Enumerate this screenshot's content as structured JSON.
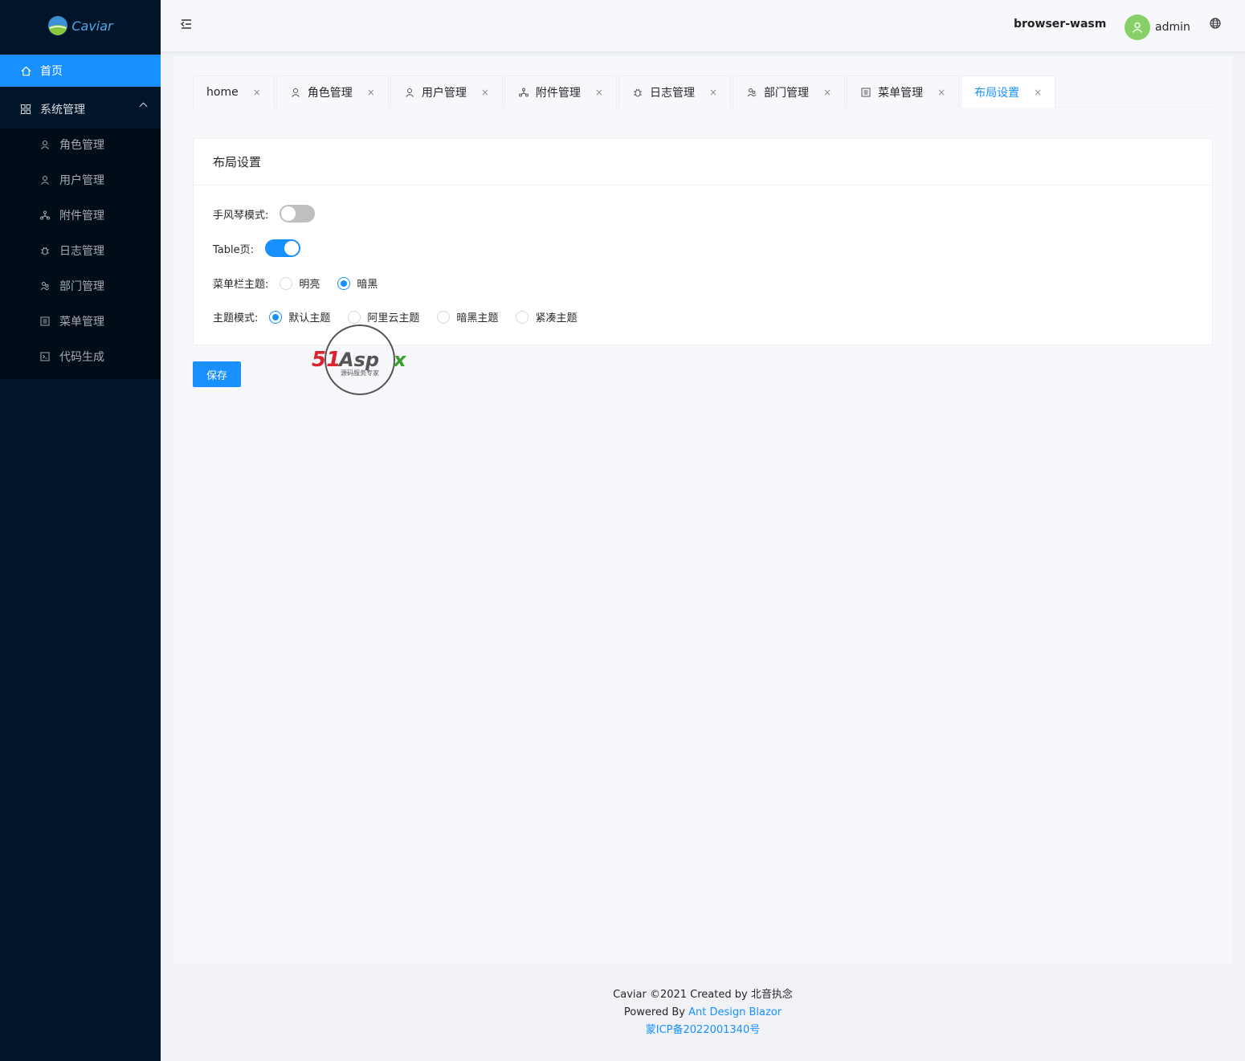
{
  "app": {
    "logo_text": "Caviar"
  },
  "sidebar": {
    "home": "首页",
    "group": "系统管理",
    "items": [
      {
        "label": "角色管理",
        "icon": "user-role-icon"
      },
      {
        "label": "用户管理",
        "icon": "user-icon"
      },
      {
        "label": "附件管理",
        "icon": "cluster-icon"
      },
      {
        "label": "日志管理",
        "icon": "bug-icon"
      },
      {
        "label": "部门管理",
        "icon": "team-icon"
      },
      {
        "label": "菜单管理",
        "icon": "profile-icon"
      },
      {
        "label": "代码生成",
        "icon": "code-icon"
      }
    ]
  },
  "header": {
    "env": "browser-wasm",
    "username": "admin"
  },
  "tabs": [
    {
      "label": "home",
      "close": "×"
    },
    {
      "label": "角色管理",
      "close": "×"
    },
    {
      "label": "用户管理",
      "close": "×"
    },
    {
      "label": "附件管理",
      "close": "×"
    },
    {
      "label": "日志管理",
      "close": "×"
    },
    {
      "label": "部门管理",
      "close": "×"
    },
    {
      "label": "菜单管理",
      "close": "×"
    },
    {
      "label": "布局设置",
      "close": "×"
    }
  ],
  "card": {
    "title": "布局设置",
    "accordion_label": "手风琴模式:",
    "accordion_on": false,
    "table_label": "Table页:",
    "table_on": true,
    "menu_theme_label": "菜单栏主题:",
    "menu_theme_options": [
      "明亮",
      "暗黑"
    ],
    "menu_theme_selected": "暗黑",
    "theme_mode_label": "主题模式:",
    "theme_mode_options": [
      "默认主题",
      "阿里云主题",
      "暗黑主题",
      "紧凑主题"
    ],
    "theme_mode_selected": "默认主题"
  },
  "save_label": "保存",
  "watermark": {
    "brand": "51Aspx",
    "tagline": "源码服务专家"
  },
  "footer": {
    "line1": "Caviar ©2021 Created by 北音执念",
    "powered_prefix": "Powered By ",
    "powered_link": "Ant Design Blazor",
    "icp": "蒙ICP备2022001340号"
  },
  "colors": {
    "sider_bg": "#001529",
    "primary": "#1890ff",
    "avatar_bg": "#87d068"
  }
}
